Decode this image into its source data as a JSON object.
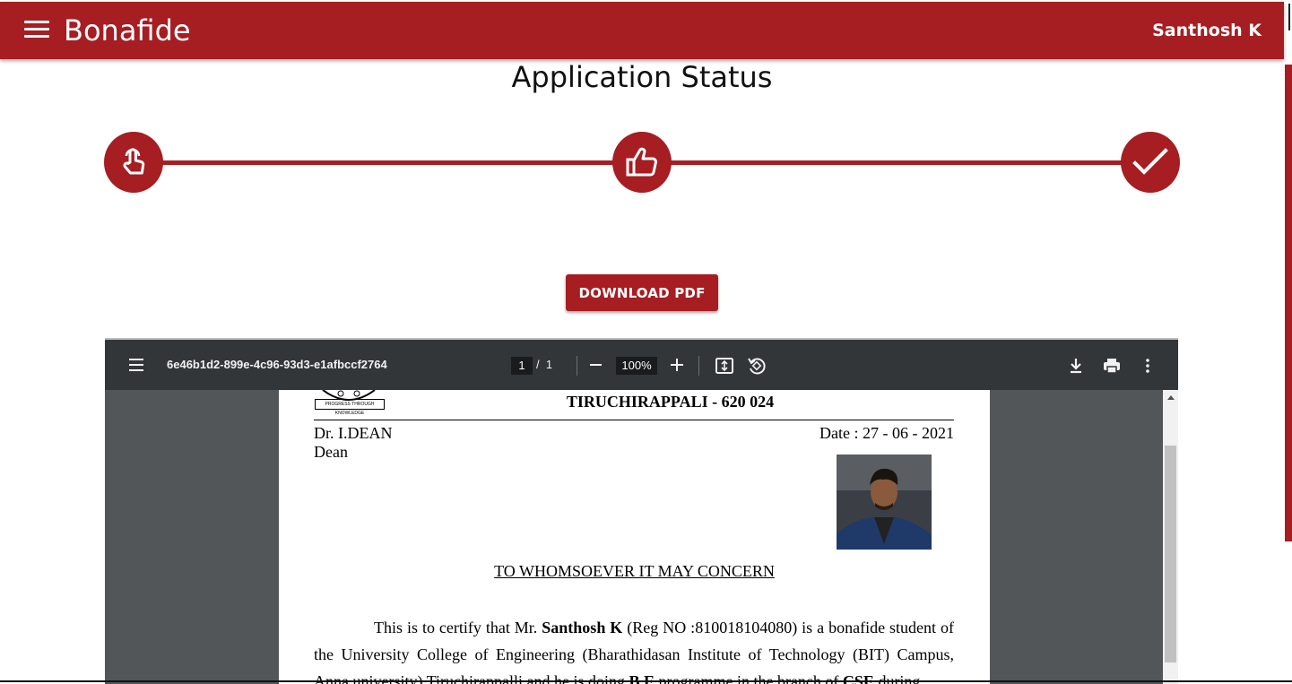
{
  "appbar": {
    "title": "Bonafide",
    "user_name": "Santhosh K",
    "menu_icon": "menu-icon"
  },
  "status": {
    "title": "Application Status",
    "steps": [
      {
        "name": "applied",
        "icon": "touch-icon"
      },
      {
        "name": "approved",
        "icon": "thumbs-up-icon"
      },
      {
        "name": "completed",
        "icon": "check-icon"
      }
    ]
  },
  "download": {
    "label": "DOWNLOAD PDF"
  },
  "pdf_viewer": {
    "file_name": "6e46b1d2-899e-4c96-93d3-e1afbccf2764",
    "page_current": "1",
    "page_separator": "/",
    "page_total": "1",
    "zoom": "100%",
    "icons": [
      "menu-icon",
      "zoom-out-icon",
      "zoom-in-icon",
      "fit-page-icon",
      "rotate-icon",
      "download-icon",
      "print-icon",
      "more-vert-icon"
    ]
  },
  "document": {
    "logo_text": "PROGRESS THROUGH KNOWLEDGE",
    "college_line": "TIRUCHIRAPPALI - 620 024",
    "to_name": "Dr. I.DEAN",
    "to_title": "Dean",
    "date": "Date : 27 - 06 - 2021",
    "heading": "TO WHOMSOEVER IT MAY CONCERN",
    "body": {
      "p1_a": "This is to certify that Mr. ",
      "student_name": "Santhosh K",
      "p1_b": " (Reg NO :810018104080) is a bonafide student of the University College of Engineering (Bharathidasan Institute of Technology (BIT) Campus, Anna university) Tiruchirappalli and he is doing ",
      "programme": "B.E",
      "p1_c": " programme in the branch of ",
      "branch": "CSE",
      "p1_d": " during"
    }
  },
  "colors": {
    "brand": "#a61d22",
    "pdf_toolbar": "#323639",
    "pdf_background": "#525659"
  }
}
